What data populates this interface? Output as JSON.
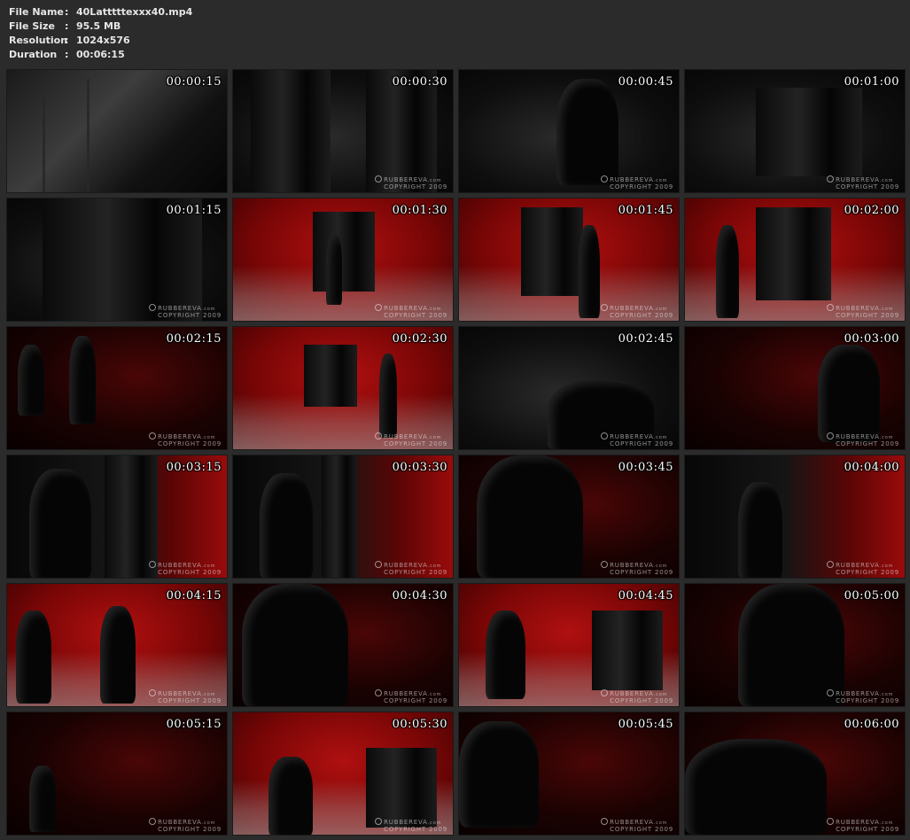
{
  "file_info": {
    "file_name_label": "File Name",
    "file_name": "40Latttttexxx40.mp4",
    "file_size_label": "File Size",
    "file_size": "95.5 MB",
    "resolution_label": "Resolution",
    "resolution": "1024x576",
    "duration_label": "Duration",
    "duration": "00:06:15",
    "separator": ":"
  },
  "watermark": {
    "brand": "RUBBEREVA",
    "tld": ".com",
    "copyright": "COPYRIGHT 2009"
  },
  "thumbnails": [
    {
      "time": "00:00:15",
      "tone": "gray"
    },
    {
      "time": "00:00:30",
      "tone": "dark"
    },
    {
      "time": "00:00:45",
      "tone": "dark"
    },
    {
      "time": "00:01:00",
      "tone": "dark"
    },
    {
      "time": "00:01:15",
      "tone": "dark"
    },
    {
      "time": "00:01:30",
      "tone": "red"
    },
    {
      "time": "00:01:45",
      "tone": "red"
    },
    {
      "time": "00:02:00",
      "tone": "red"
    },
    {
      "time": "00:02:15",
      "tone": "darkred"
    },
    {
      "time": "00:02:30",
      "tone": "red"
    },
    {
      "time": "00:02:45",
      "tone": "dark"
    },
    {
      "time": "00:03:00",
      "tone": "darkred"
    },
    {
      "time": "00:03:15",
      "tone": "mixed"
    },
    {
      "time": "00:03:30",
      "tone": "mixed"
    },
    {
      "time": "00:03:45",
      "tone": "darkred"
    },
    {
      "time": "00:04:00",
      "tone": "mixed"
    },
    {
      "time": "00:04:15",
      "tone": "red"
    },
    {
      "time": "00:04:30",
      "tone": "darkred"
    },
    {
      "time": "00:04:45",
      "tone": "red"
    },
    {
      "time": "00:05:00",
      "tone": "darkred"
    },
    {
      "time": "00:05:15",
      "tone": "darkred"
    },
    {
      "time": "00:05:30",
      "tone": "red"
    },
    {
      "time": "00:05:45",
      "tone": "darkred"
    },
    {
      "time": "00:06:00",
      "tone": "darkred"
    }
  ]
}
